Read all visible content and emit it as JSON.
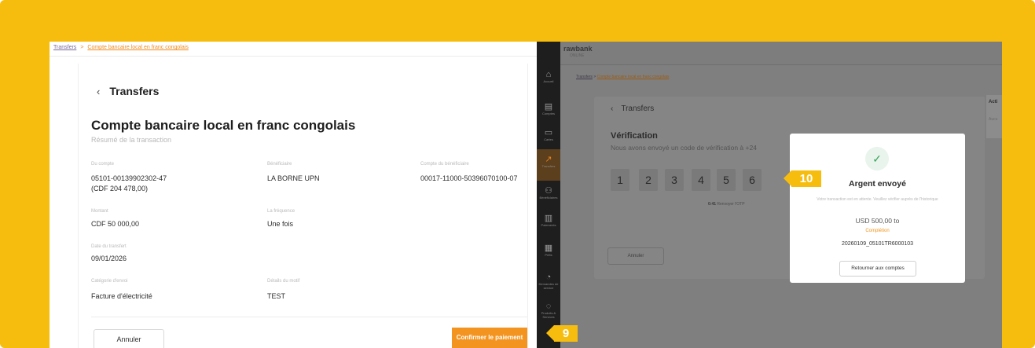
{
  "colors": {
    "frame": "#f6bd0e",
    "accent": "#f39420",
    "success": "#39a45a"
  },
  "left": {
    "breadcrumb": {
      "root": "Transfers",
      "separator": ">",
      "current": "Compte bancaire local en franc congolais"
    },
    "back_label": "Transfers",
    "back_icon": "chevron-left-icon",
    "title": "Compte bancaire local en franc congolais",
    "subtitle": "Résumé de la transaction",
    "fields": {
      "from_account": {
        "label": "Du compte",
        "value": "05101-00139902302-47",
        "value2": "(CDF 204 478,00)"
      },
      "beneficiary": {
        "label": "Bénéficiaire",
        "value": "LA BORNE UPN"
      },
      "beneficiary_account": {
        "label": "Compte du bénéficiaire",
        "value": "00017-11000-50396070100-07"
      },
      "amount": {
        "label": "Montant",
        "value": "CDF 50 000,00"
      },
      "frequency": {
        "label": "La fréquence",
        "value": "Une fois"
      },
      "transfer_date": {
        "label": "Date du transfert",
        "value": "09/01/2026"
      },
      "category": {
        "label": "Catégorie d'envoi",
        "value": "Facture d'électricité"
      },
      "reason": {
        "label": "Détails du motif",
        "value": "TEST"
      }
    },
    "cancel_label": "Annuler",
    "confirm_label": "Confirmer le paiement"
  },
  "right": {
    "logo": {
      "name": "rawbank",
      "tagline": "ONLINE"
    },
    "sidebar": [
      {
        "icon": "home-icon",
        "glyph": "⌂",
        "label": "Accueil"
      },
      {
        "icon": "bank-icon",
        "glyph": "▤",
        "label": "Comptes"
      },
      {
        "icon": "card-icon",
        "glyph": "▭",
        "label": "Cartes"
      },
      {
        "icon": "transfer-icon",
        "glyph": "↗",
        "label": "Transfers"
      },
      {
        "icon": "beneficiaries-icon",
        "glyph": "⚇",
        "label": "Bénéficiaires"
      },
      {
        "icon": "payments-icon",
        "glyph": "▥",
        "label": "Paiements"
      },
      {
        "icon": "loans-icon",
        "glyph": "▦",
        "label": "Prêts"
      },
      {
        "icon": "service-icon",
        "glyph": "◔",
        "label": "Demandes de service"
      },
      {
        "icon": "products-icon",
        "glyph": "◌",
        "label": "Produits & Services"
      }
    ],
    "breadcrumb": {
      "root": "Transfers",
      "separator": ">",
      "current": "Compte bancaire local en franc congolais"
    },
    "back_label": "Transfers",
    "verification_title": "Vérification",
    "verification_text": "Nous avons envoyé un code de vérification à +24",
    "otp": [
      "1",
      "2",
      "3",
      "4",
      "5",
      "6"
    ],
    "resend_timer": "0:41",
    "resend_label": "Renvoyer l'OTP",
    "cancel_label": "Annuler",
    "side_card": {
      "title": "Acti",
      "text": "Aucu"
    }
  },
  "modal": {
    "icon": "check-icon",
    "title": "Argent envoyé",
    "text": "Votre transaction est en attente. Veuillez vérifier auprès de l'historique",
    "amount": "USD 500,00 to",
    "status": "Complétion",
    "reference": "20260109_05101TR6000103",
    "button_label": "Retourner aux comptes"
  },
  "callouts": {
    "step9": "9",
    "step10": "10"
  }
}
